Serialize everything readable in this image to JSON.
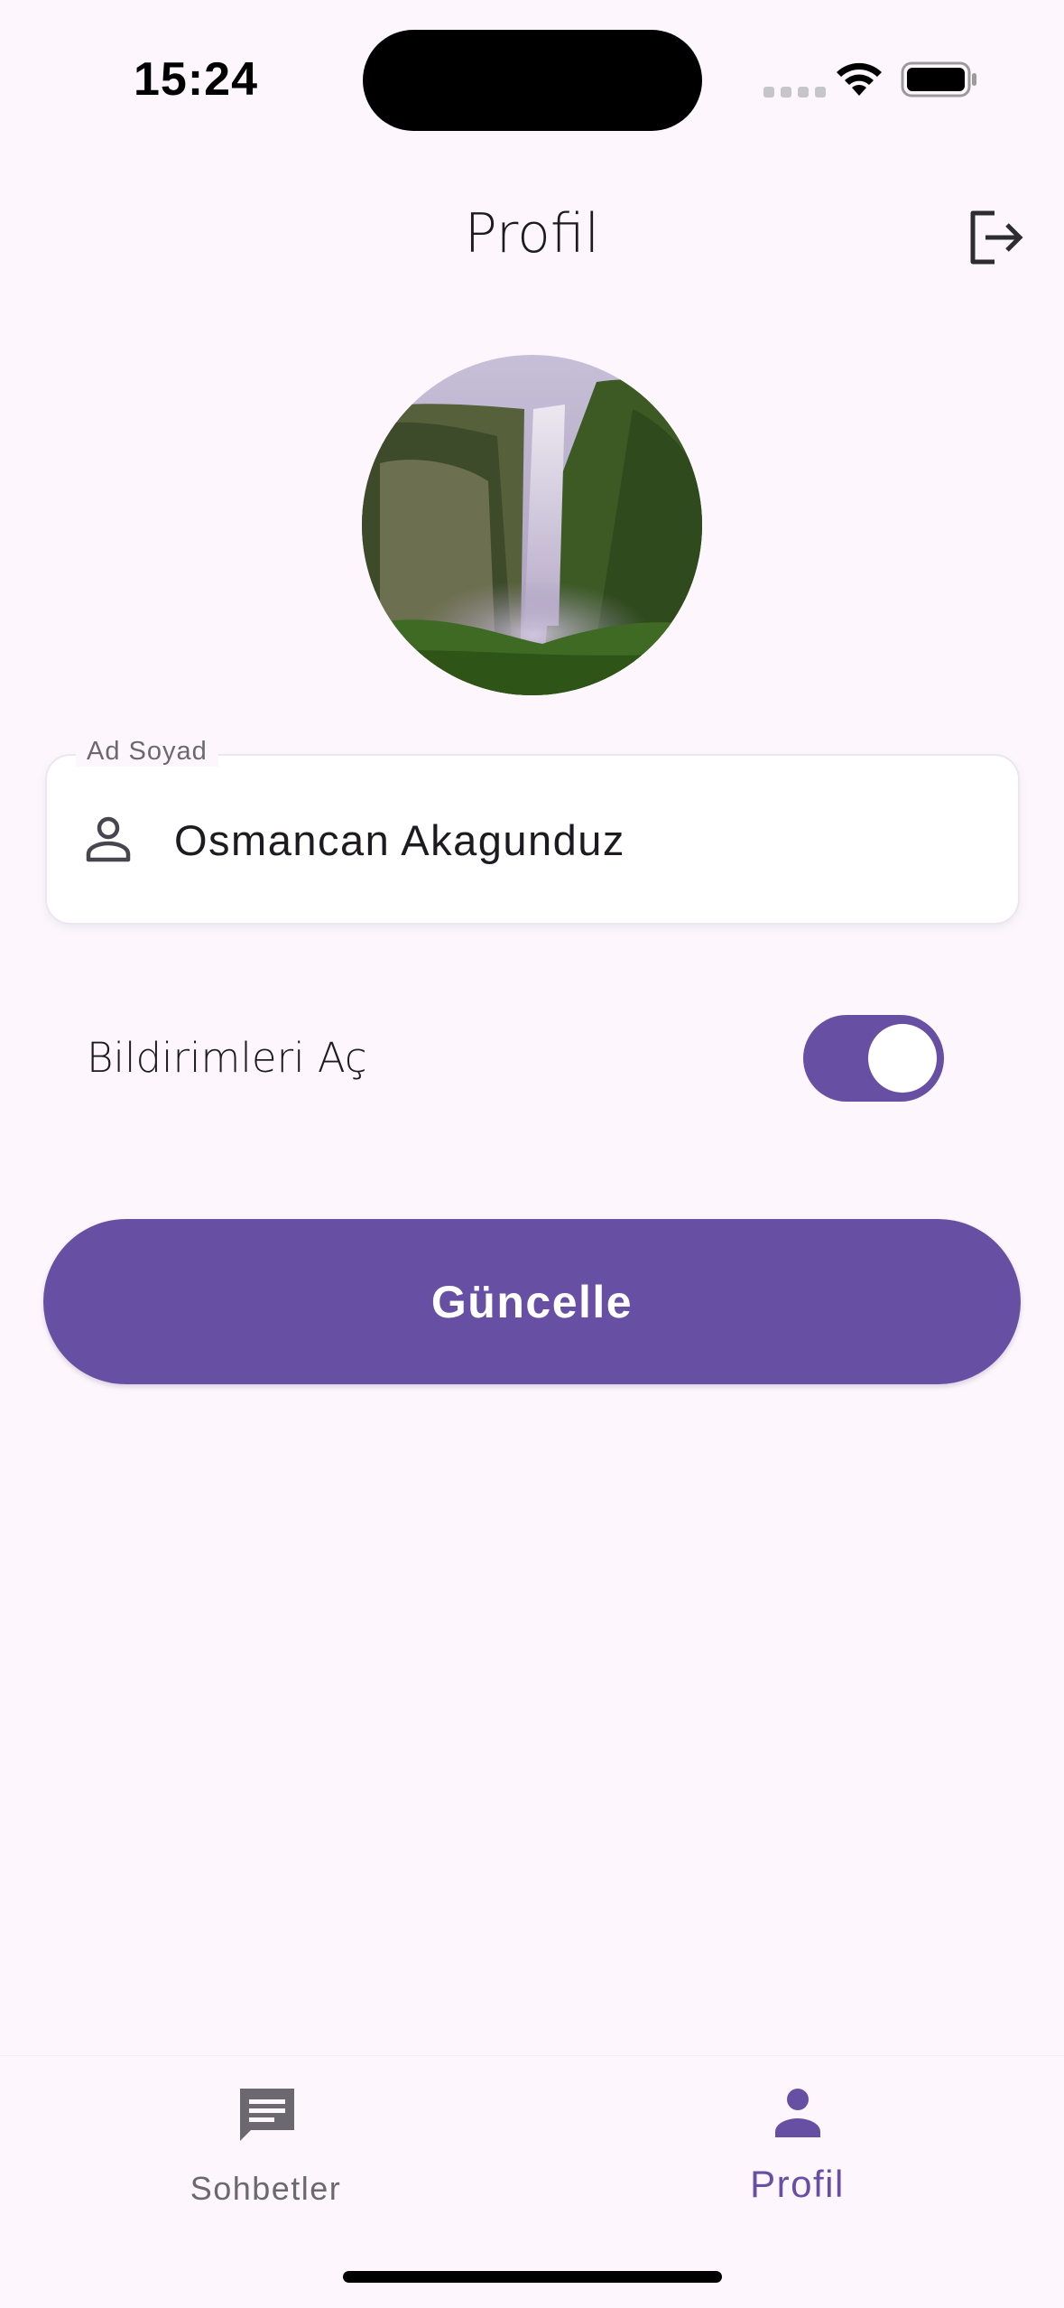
{
  "status_bar": {
    "time": "15:24"
  },
  "header": {
    "title": "Profil",
    "logout_icon": "logout-icon"
  },
  "profile_form": {
    "name_label": "Ad Soyad",
    "name_value": "Osmancan Akagunduz",
    "notifications_label": "Bildirimleri Aç",
    "notifications_enabled": true,
    "update_button": "Güncelle"
  },
  "bottom_nav": {
    "items": [
      {
        "label": "Sohbetler",
        "icon": "chat-icon",
        "active": false
      },
      {
        "label": "Profil",
        "icon": "person-icon",
        "active": true
      }
    ]
  },
  "colors": {
    "primary": "#6750a4",
    "background": "#fdf7fd",
    "inactive": "#6c6870"
  }
}
